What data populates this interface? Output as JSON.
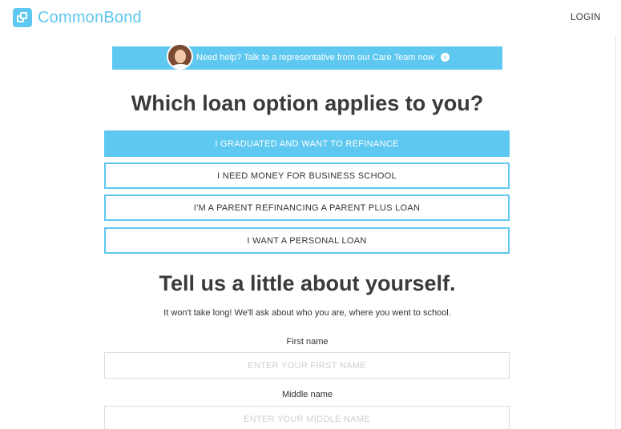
{
  "header": {
    "brand": "CommonBond",
    "login_label": "LOGIN"
  },
  "help_banner": {
    "text": "Need help? Talk to a representative from our Care Team now",
    "arrow_icon": "chevron-right-circle-icon"
  },
  "loan_section": {
    "title": "Which loan option applies to you?",
    "options": [
      {
        "label": "I GRADUATED AND WANT TO REFINANCE",
        "selected": true
      },
      {
        "label": "I NEED MONEY FOR BUSINESS SCHOOL",
        "selected": false
      },
      {
        "label": "I'M A PARENT REFINANCING A PARENT PLUS LOAN",
        "selected": false
      },
      {
        "label": "I WANT A PERSONAL LOAN",
        "selected": false
      }
    ]
  },
  "about_section": {
    "title": "Tell us a little about yourself.",
    "subtitle": "It won't take long! We'll ask about who you are, where you went to school.",
    "fields": [
      {
        "label": "First name",
        "placeholder": "ENTER YOUR FIRST NAME",
        "value": ""
      },
      {
        "label": "Middle name",
        "placeholder": "ENTER YOUR MIDDLE NAME",
        "value": ""
      }
    ]
  },
  "colors": {
    "accent": "#5ec8f0",
    "heading": "#3a3a3a",
    "placeholder": "#cfcfcf"
  }
}
